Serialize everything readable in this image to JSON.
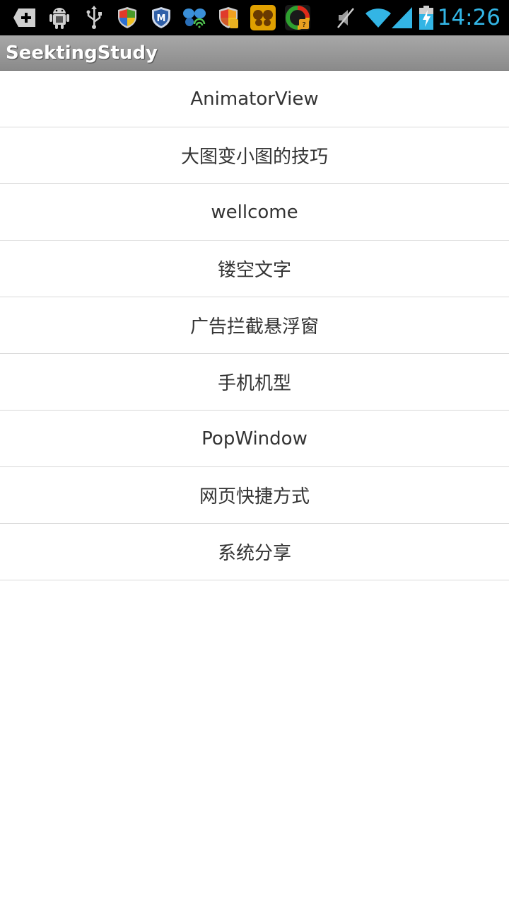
{
  "status_bar": {
    "time": "14:26",
    "icons": [
      "add-notification-icon",
      "android-debug-icon",
      "usb-icon",
      "shield-icon",
      "m-shield-icon",
      "butterfly-wifi-icon",
      "shield-alert-icon",
      "app-butterfly-icon",
      "app-shield-icon",
      "mute-icon",
      "wifi-icon",
      "signal-icon",
      "battery-charging-icon"
    ],
    "clock_color": "#33b5e5"
  },
  "action_bar": {
    "title": "SeektingStudy"
  },
  "list": {
    "items": [
      {
        "label": "AnimatorView"
      },
      {
        "label": "大图变小图的技巧"
      },
      {
        "label": "wellcome"
      },
      {
        "label": "镂空文字"
      },
      {
        "label": "广告拦截悬浮窗"
      },
      {
        "label": "手机机型"
      },
      {
        "label": "PopWindow"
      },
      {
        "label": "网页快捷方式"
      },
      {
        "label": "系统分享"
      }
    ]
  }
}
